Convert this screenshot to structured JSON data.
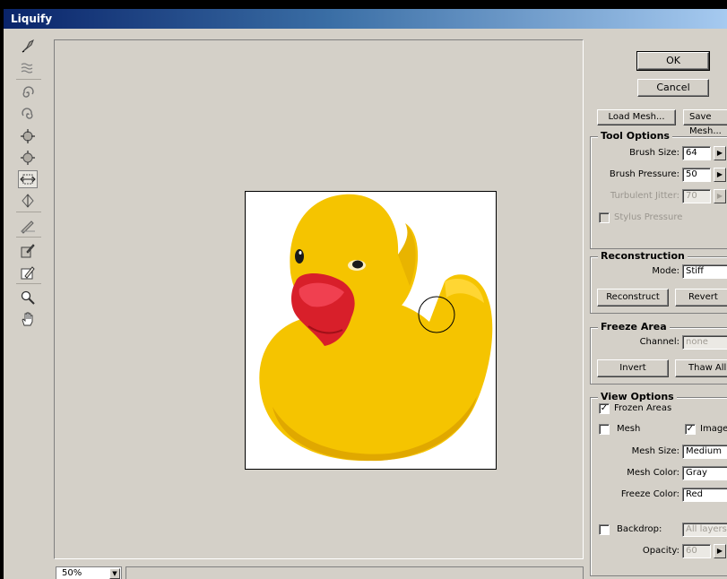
{
  "window": {
    "title": "Liquify"
  },
  "toolbar": {
    "tools": [
      {
        "name": "forward-warp-tool-icon"
      },
      {
        "name": "turbulence-tool-icon"
      },
      {
        "name": "twirl-clockwise-tool-icon"
      },
      {
        "name": "twirl-counterclockwise-tool-icon"
      },
      {
        "name": "pucker-tool-icon"
      },
      {
        "name": "bloat-tool-icon"
      },
      {
        "name": "shift-pixels-tool-icon",
        "active": true
      },
      {
        "name": "reflection-tool-icon"
      },
      {
        "name": "reconstruct-tool-icon"
      },
      {
        "name": "freeze-tool-icon"
      },
      {
        "name": "thaw-tool-icon"
      },
      {
        "name": "zoom-tool-icon"
      },
      {
        "name": "hand-tool-icon"
      }
    ]
  },
  "canvas": {
    "zoom": "50%"
  },
  "buttons": {
    "ok": "OK",
    "cancel": "Cancel",
    "load_mesh": "Load Mesh...",
    "save_mesh": "Save Mesh..."
  },
  "tool_options": {
    "title": "Tool Options",
    "brush_size_label": "Brush Size:",
    "brush_size": "64",
    "brush_pressure_label": "Brush Pressure:",
    "brush_pressure": "50",
    "turbulent_jitter_label": "Turbulent Jitter:",
    "turbulent_jitter": "70",
    "stylus_pressure_label": "Stylus Pressure"
  },
  "reconstruction": {
    "title": "Reconstruction",
    "mode_label": "Mode:",
    "mode": "Stiff",
    "reconstruct": "Reconstruct",
    "revert": "Revert"
  },
  "freeze_area": {
    "title": "Freeze Area",
    "channel_label": "Channel:",
    "channel": "none",
    "invert": "Invert",
    "thaw_all": "Thaw All"
  },
  "view_options": {
    "title": "View Options",
    "frozen_areas_label": "Frozen Areas",
    "frozen_areas_checked": true,
    "mesh_label": "Mesh",
    "mesh_checked": false,
    "image_label": "Image",
    "image_checked": true,
    "mesh_size_label": "Mesh Size:",
    "mesh_size": "Medium",
    "mesh_color_label": "Mesh Color:",
    "mesh_color": "Gray",
    "freeze_color_label": "Freeze Color:",
    "freeze_color": "Red",
    "backdrop_label": "Backdrop:",
    "backdrop_checked": false,
    "backdrop_value": "All layers",
    "opacity_label": "Opacity:",
    "opacity": "60"
  },
  "colors": {
    "window_bg": "#d4d0c8",
    "title_start": "#0a246a",
    "title_end": "#a6caf0",
    "duck_yellow": "#f5c400",
    "duck_beak": "#d81f2a"
  }
}
